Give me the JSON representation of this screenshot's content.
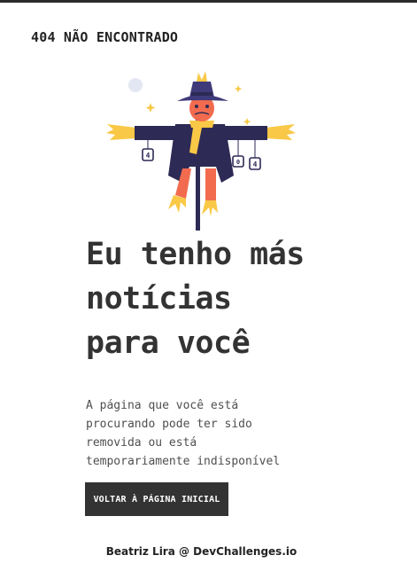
{
  "header": {
    "brand": "404 NÃO ENCONTRADO"
  },
  "hero": {
    "headline_lines": [
      "Eu tenho más",
      "notícias",
      "para você"
    ],
    "description_lines": [
      "A página que você está",
      "procurando pode ter sido",
      "removida ou está",
      "temporariamente indisponível"
    ],
    "button_label": "VOLTAR À PÁGINA INICIAL",
    "illustration": {
      "icon": "scarecrow-illustration",
      "sign_text": "4",
      "sign_text_2": "0"
    }
  },
  "footer": {
    "credit": "Beatriz Lira @ DevChallenges.io"
  },
  "colors": {
    "text": "#333333",
    "button_bg": "#333333",
    "hat": "#3f3a7a",
    "face": "#f26b4f",
    "straw": "#f9c846",
    "coat": "#2d2a55"
  }
}
